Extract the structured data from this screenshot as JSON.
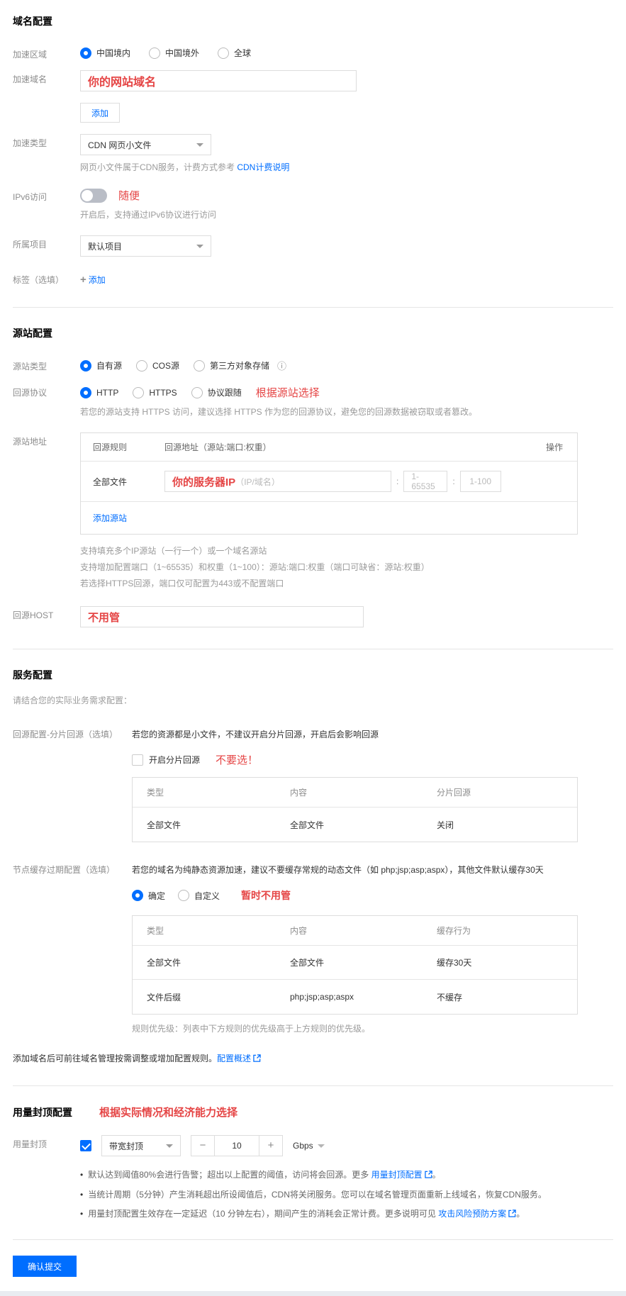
{
  "colors": {
    "accent_blue": "#006eff",
    "annotation_red": "#e54545",
    "border": "#dddddd"
  },
  "domain_section": {
    "title": "域名配置",
    "region": {
      "label": "加速区域",
      "options": [
        {
          "label": "中国境内",
          "selected": true
        },
        {
          "label": "中国境外",
          "selected": false
        },
        {
          "label": "全球",
          "selected": false
        }
      ]
    },
    "domain": {
      "label": "加速域名",
      "value": "你的网站域名"
    },
    "add_button": "添加",
    "type": {
      "label": "加速类型",
      "value": "CDN 网页小文件",
      "help_prefix": "网页小文件属于CDN服务，计费方式参考 ",
      "help_link": "CDN计费说明"
    },
    "ipv6": {
      "label": "IPv6访问",
      "annotation": "随便",
      "help": "开启后，支持通过IPv6协议进行访问"
    },
    "project": {
      "label": "所属项目",
      "value": "默认项目"
    },
    "tag": {
      "label": "标签（选填）",
      "plus": "+",
      "add_link": "添加"
    }
  },
  "origin_section": {
    "title": "源站配置",
    "origin_type": {
      "label": "源站类型",
      "options": [
        {
          "label": "自有源",
          "selected": true
        },
        {
          "label": "COS源",
          "selected": false
        },
        {
          "label": "第三方对象存储",
          "selected": false
        }
      ],
      "info_icon": "ⓘ"
    },
    "protocol": {
      "label": "回源协议",
      "options": [
        {
          "label": "HTTP",
          "selected": true
        },
        {
          "label": "HTTPS",
          "selected": false
        },
        {
          "label": "协议跟随",
          "selected": false
        }
      ],
      "annotation": "根据源站选择",
      "help": "若您的源站支持 HTTPS 访问，建议选择 HTTPS 作为您的回源协议，避免您的回源数据被窃取或者篡改。"
    },
    "address": {
      "label": "源站地址",
      "table": {
        "headers": [
          "回源规则",
          "回源地址（源站:端口:权重）",
          "操作"
        ],
        "rule": "全部文件",
        "input_value": "你的服务器IP",
        "input_placeholder": "（IP/域名）",
        "colon": ":",
        "port_placeholder": "1-65535",
        "weight_placeholder": "1-100",
        "add_link": "添加源站"
      },
      "help_lines": [
        "支持填充多个IP源站（一行一个）或一个域名源站",
        "支持增加配置端口（1~65535）和权重（1~100）：源站:端口:权重（端口可缺省：源站:权重）",
        "若选择HTTPS回源，端口仅可配置为443或不配置端口"
      ]
    },
    "host": {
      "label": "回源HOST",
      "value": "不用管"
    }
  },
  "service_section": {
    "title": "服务配置",
    "intro": "请结合您的实际业务需求配置：",
    "range_origin": {
      "label": "回源配置-分片回源（选填）",
      "help": "若您的资源都是小文件，不建议开启分片回源，开启后会影响回源",
      "checkbox_label": "开启分片回源",
      "annotation": "不要选！",
      "table": {
        "headers": [
          "类型",
          "内容",
          "分片回源"
        ],
        "rows": [
          [
            "全部文件",
            "全部文件",
            "关闭"
          ]
        ]
      }
    },
    "cache": {
      "label": "节点缓存过期配置（选填）",
      "help": "若您的域名为纯静态资源加速，建议不要缓存常规的动态文件（如 php;jsp;asp;aspx），其他文件默认缓存30天",
      "options": [
        {
          "label": "确定",
          "selected": true
        },
        {
          "label": "自定义",
          "selected": false
        }
      ],
      "annotation": "暂时不用管",
      "table": {
        "headers": [
          "类型",
          "内容",
          "缓存行为"
        ],
        "rows": [
          [
            "全部文件",
            "全部文件",
            "缓存30天"
          ],
          [
            "文件后缀",
            "php;jsp;asp;aspx",
            "不缓存"
          ]
        ]
      },
      "note": "规则优先级：列表中下方规则的优先级高于上方规则的优先级。"
    },
    "footer_prefix": "添加域名后可前往域名管理按需调整或增加配置规则。",
    "footer_link": "配置概述"
  },
  "cap_section": {
    "title": "用量封顶配置",
    "annotation": "根据实际情况和经济能力选择",
    "cap": {
      "label": "用量封顶",
      "type_value": "带宽封顶",
      "minus": "−",
      "amount": "10",
      "plus": "+",
      "unit": "Gbps"
    },
    "bullets": [
      {
        "prefix": "默认达到阈值80%会进行告警；超出以上配置的阈值，访问将会回源。更多 ",
        "link": "用量封顶配置",
        "suffix": "。"
      },
      {
        "prefix": "当统计周期（5分钟）产生消耗超出所设阈值后，CDN将关闭服务。您可以在域名管理页面重新上线域名，恢复CDN服务。",
        "link": "",
        "suffix": ""
      },
      {
        "prefix": "用量封顶配置生效存在一定延迟（10 分钟左右），期间产生的消耗会正常计费。更多说明可见 ",
        "link": "攻击风险预防方案",
        "suffix": "。"
      }
    ]
  },
  "submit_button": "确认提交"
}
